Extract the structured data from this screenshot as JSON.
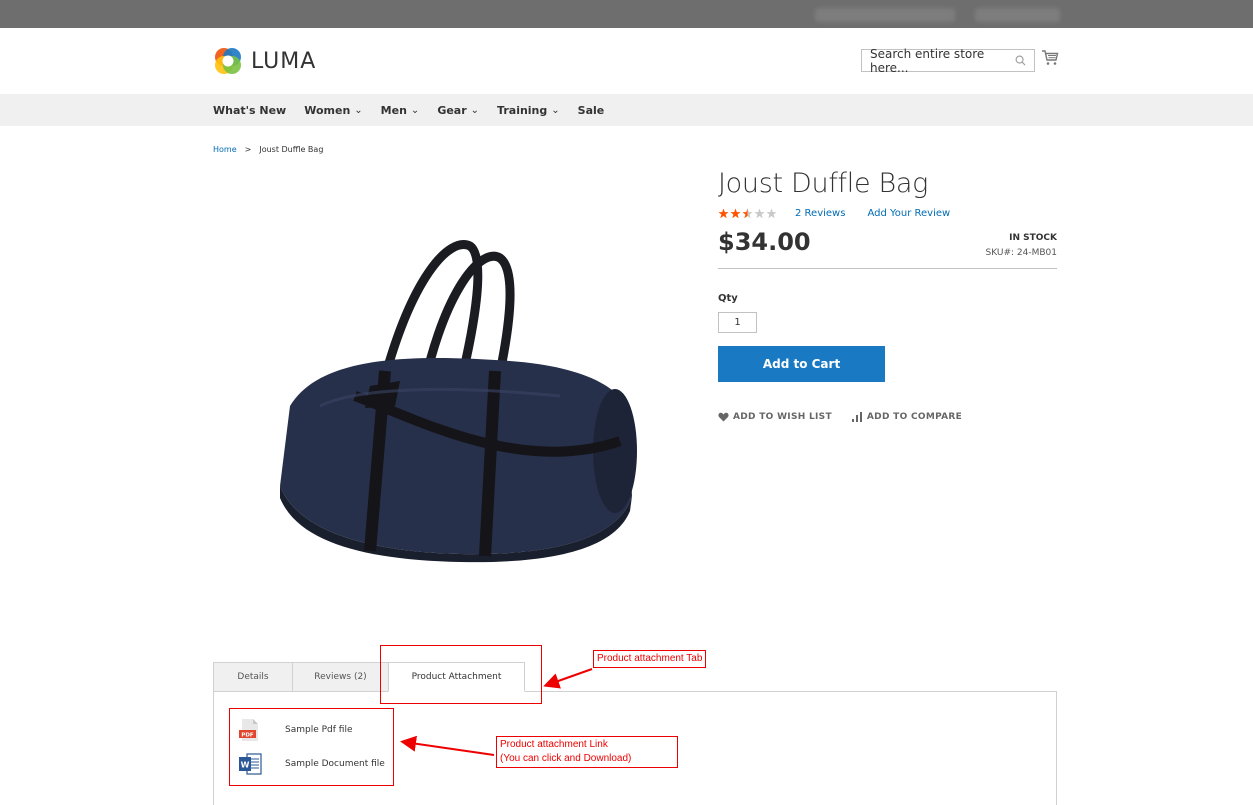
{
  "header": {
    "logo_text": "LUMA",
    "search_placeholder": "Search entire store here...",
    "search_icon": "search-icon",
    "cart_icon": "cart-icon"
  },
  "nav": {
    "items": [
      {
        "label": "What's New",
        "has_dropdown": false
      },
      {
        "label": "Women",
        "has_dropdown": true
      },
      {
        "label": "Men",
        "has_dropdown": true
      },
      {
        "label": "Gear",
        "has_dropdown": true
      },
      {
        "label": "Training",
        "has_dropdown": true
      },
      {
        "label": "Sale",
        "has_dropdown": false
      }
    ]
  },
  "breadcrumb": {
    "home": "Home",
    "separator": ">",
    "current": "Joust Duffle Bag"
  },
  "product": {
    "title": "Joust Duffle Bag",
    "rating_stars": 2.5,
    "rating_max": 5,
    "reviews_link": "2  Reviews",
    "add_review_link": "Add Your Review",
    "price": "$34.00",
    "stock": "IN STOCK",
    "sku_label": "SKU#:",
    "sku": "24-MB01",
    "qty_label": "Qty",
    "qty_value": "1",
    "add_to_cart": "Add to Cart",
    "wishlist": "ADD TO WISH LIST",
    "compare": "ADD TO COMPARE"
  },
  "tabs": {
    "details": "Details",
    "reviews": "Reviews (2)",
    "attachment": "Product Attachment"
  },
  "attachments": {
    "pdf_label": "Sample Pdf file",
    "pdf_badge": "PDF",
    "doc_label": "Sample Document file",
    "doc_badge": "W"
  },
  "annotations": {
    "tab_note": "Product attachment Tab",
    "link_note_line1": "Product attachment Link",
    "link_note_line2": "(You can click and Download)"
  },
  "colors": {
    "accent": "#1979c3",
    "link": "#006bb4",
    "star": "#ff5501",
    "annotation": "#e00000"
  }
}
